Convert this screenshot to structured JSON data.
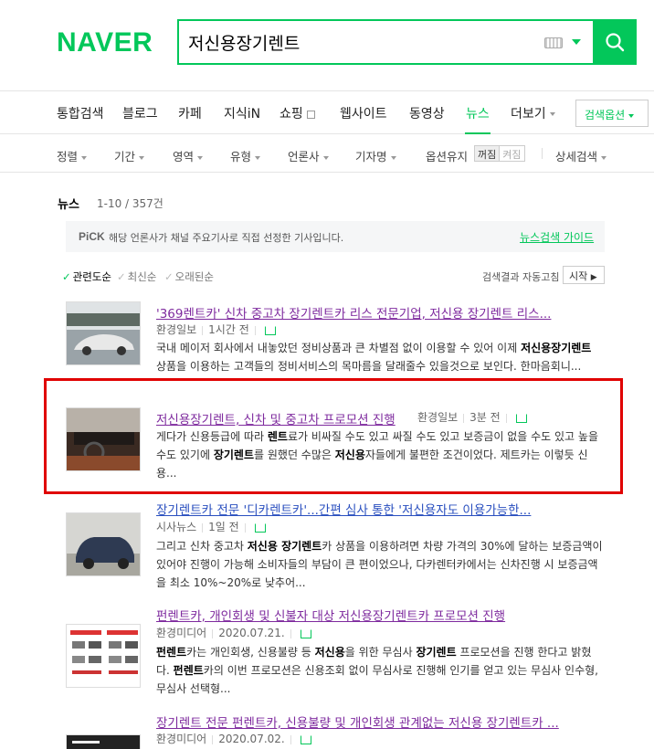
{
  "header": {
    "logo": "NAVER",
    "search_value": "저신용장기렌트"
  },
  "tabs": [
    {
      "label": "통합검색"
    },
    {
      "label": "블로그"
    },
    {
      "label": "카페"
    },
    {
      "label": "지식iN"
    },
    {
      "label": "쇼핑"
    },
    {
      "label": "웹사이트"
    },
    {
      "label": "동영상"
    },
    {
      "label": "뉴스"
    },
    {
      "label": "더보기"
    }
  ],
  "search_options": "검색옵션",
  "filters": [
    {
      "label": "정렬"
    },
    {
      "label": "기간"
    },
    {
      "label": "영역"
    },
    {
      "label": "유형"
    },
    {
      "label": "언론사"
    },
    {
      "label": "기자명"
    },
    {
      "label": "옵션유지"
    },
    {
      "label": "상세검색"
    }
  ],
  "toggle": {
    "on": "꺼짐",
    "off": "켜짐"
  },
  "section": {
    "title": "뉴스",
    "count": "1-10 / 357건"
  },
  "pick": {
    "label": "PiCK",
    "text": "해당 언론사가 채널 주요기사로 직접 선정한 기사입니다.",
    "guide": "뉴스검색 가이드"
  },
  "sort": [
    {
      "label": "관련도순"
    },
    {
      "label": "최신순"
    },
    {
      "label": "오래된순"
    }
  ],
  "auto_refresh": {
    "text": "검색결과 자동고침",
    "button": "시작"
  },
  "results": [
    {
      "title": "'369렌트카' 신차 중고차 장기렌트카 리스 전문기업, 저신용 장기렌트 리스...",
      "press": "환경일보",
      "time": "1시간 전",
      "desc_parts": [
        "국내 메이저 회사에서 내놓았던 정비상품과 큰 차별점 없이 이용할 수 있어 이제 ",
        "저신용장기렌트",
        " 상품을 이용하는 고객들의 정비서비스의 목마름을 달래줄수 있을것으로 보인다. 한마음회니..."
      ]
    },
    {
      "title": "저신용장기렌트, 신차 및 중고차 프로모션 진행",
      "press": "환경일보",
      "time": "3분 전",
      "desc_parts": [
        "게다가 신용등급에 따라 ",
        "렌트",
        "료가 비싸질 수도 있고 싸질 수도 있고 보증금이 없을 수도 있고 높을 수도 있기에 ",
        "장기렌트",
        "를 원했던 수많은 ",
        "저신용",
        "자들에게 불편한 조건이었다. 제트카는 이렇듯 신용..."
      ]
    },
    {
      "title": "장기렌트카 전문 '디카렌트카'...간편 심사 통한 '저신용자도 이용가능한...",
      "press": "시사뉴스",
      "time": "1일 전",
      "desc_parts": [
        "그리고 신차 중고차 ",
        "저신용 장기렌트",
        "카 상품을 이용하려면 차량 가격의 30%에 달하는 보증금액이 있어야 진행이 가능해 소비자들의 부담이 큰 편이었으나, 다카렌터카에서는 신차진행 시 보증금액을 최소 10%~20%로 낮추어..."
      ]
    },
    {
      "title": "펀렌트카, 개인회생 및 신불자 대상 저신용장기렌트카 프로모션 진행",
      "press": "환경미디어",
      "time": "2020.07.21.",
      "desc_parts": [
        "펀렌트",
        "카는 개인회생, 신용불량 등 ",
        "저신용",
        "을 위한 무심사 ",
        "장기렌트",
        " 프로모션을 진행 한다고 밝혔다. ",
        "펀렌트",
        "카의 이번 프로모션은 신용조회 없이 무심사로 진행해 인기를 얻고 있는 무심사 인수형, 무심사 선택형..."
      ]
    },
    {
      "title": "장기렌트 전문 펀렌트카, 신용불량 및 개인회생 관계없는 저신용 장기렌트카 ...",
      "press": "환경미디어",
      "time": "2020.07.02."
    }
  ]
}
